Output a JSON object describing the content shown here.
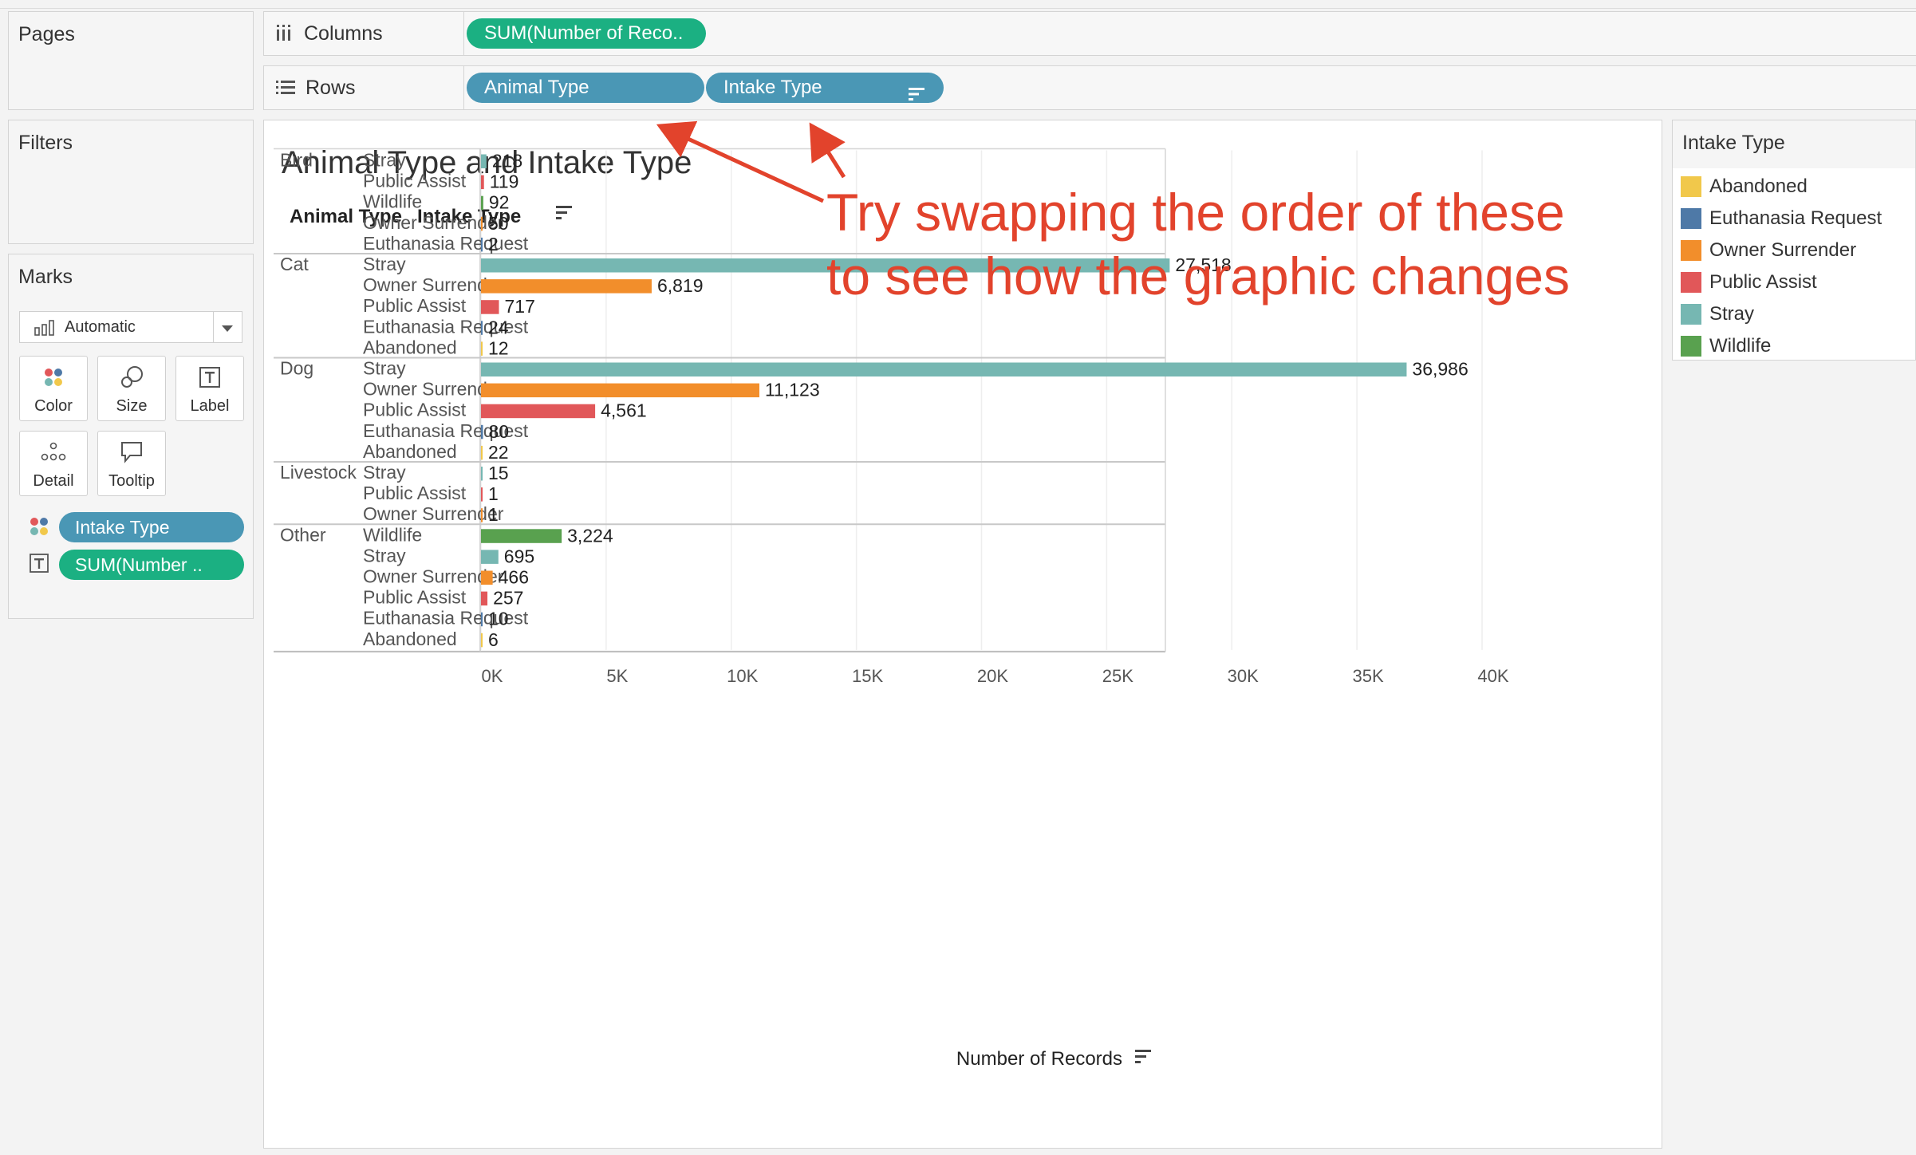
{
  "shelves": {
    "pages_title": "Pages",
    "columns_label": "Columns",
    "rows_label": "Rows",
    "columns_pill": "SUM(Number of Reco..",
    "rows_pill_1": "Animal Type",
    "rows_pill_2": "Intake Type"
  },
  "filters": {
    "title": "Filters"
  },
  "marks": {
    "title": "Marks",
    "mark_type": "Automatic",
    "cards": {
      "color": "Color",
      "size": "Size",
      "label": "Label",
      "detail": "Detail",
      "tooltip": "Tooltip"
    },
    "fields": {
      "color_field": "Intake Type",
      "label_field": "SUM(Number .."
    }
  },
  "legend": {
    "title": "Intake Type",
    "items": [
      {
        "label": "Abandoned",
        "color": "#f1c84b"
      },
      {
        "label": "Euthanasia Request",
        "color": "#4e79a7"
      },
      {
        "label": "Owner Surrender",
        "color": "#f28e2b"
      },
      {
        "label": "Public Assist",
        "color": "#e15759"
      },
      {
        "label": "Stray",
        "color": "#76b7b2"
      },
      {
        "label": "Wildlife",
        "color": "#59a14f"
      }
    ]
  },
  "annotation": {
    "line1": "Try swapping the order of these",
    "line2": "to see how the graphic changes"
  },
  "chart_data": {
    "type": "bar",
    "orientation": "horizontal",
    "title": "Animal Type and Intake Type",
    "row_headers": [
      "Animal Type",
      "Intake Type"
    ],
    "xlabel": "Number of Records",
    "xlim": [
      0,
      40000
    ],
    "xticks": [
      "0K",
      "5K",
      "10K",
      "15K",
      "20K",
      "25K",
      "30K",
      "35K",
      "40K"
    ],
    "grid": true,
    "groups": [
      {
        "name": "Bird",
        "rows": [
          {
            "intake": "Stray",
            "value": 218,
            "label": "218"
          },
          {
            "intake": "Public Assist",
            "value": 119,
            "label": "119"
          },
          {
            "intake": "Wildlife",
            "value": 92,
            "label": "92"
          },
          {
            "intake": "Owner Surrender",
            "value": 50,
            "label": "50"
          },
          {
            "intake": "Euthanasia Request",
            "value": 2,
            "label": "2"
          }
        ]
      },
      {
        "name": "Cat",
        "rows": [
          {
            "intake": "Stray",
            "value": 27518,
            "label": "27,518"
          },
          {
            "intake": "Owner Surrender",
            "value": 6819,
            "label": "6,819"
          },
          {
            "intake": "Public Assist",
            "value": 717,
            "label": "717"
          },
          {
            "intake": "Euthanasia Request",
            "value": 24,
            "label": "24"
          },
          {
            "intake": "Abandoned",
            "value": 12,
            "label": "12"
          }
        ]
      },
      {
        "name": "Dog",
        "rows": [
          {
            "intake": "Stray",
            "value": 36986,
            "label": "36,986"
          },
          {
            "intake": "Owner Surrender",
            "value": 11123,
            "label": "11,123"
          },
          {
            "intake": "Public Assist",
            "value": 4561,
            "label": "4,561"
          },
          {
            "intake": "Euthanasia Request",
            "value": 80,
            "label": "80"
          },
          {
            "intake": "Abandoned",
            "value": 22,
            "label": "22"
          }
        ]
      },
      {
        "name": "Livestock",
        "rows": [
          {
            "intake": "Stray",
            "value": 15,
            "label": "15"
          },
          {
            "intake": "Public Assist",
            "value": 1,
            "label": "1"
          },
          {
            "intake": "Owner Surrender",
            "value": 1,
            "label": "1"
          }
        ]
      },
      {
        "name": "Other",
        "rows": [
          {
            "intake": "Wildlife",
            "value": 3224,
            "label": "3,224"
          },
          {
            "intake": "Stray",
            "value": 695,
            "label": "695"
          },
          {
            "intake": "Owner Surrender",
            "value": 466,
            "label": "466"
          },
          {
            "intake": "Public Assist",
            "value": 257,
            "label": "257"
          },
          {
            "intake": "Euthanasia Request",
            "value": 10,
            "label": "10"
          },
          {
            "intake": "Abandoned",
            "value": 6,
            "label": "6"
          }
        ]
      }
    ]
  }
}
